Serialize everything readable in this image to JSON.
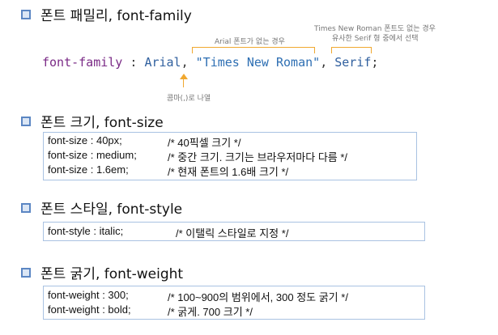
{
  "family": {
    "heading": "폰트 패밀리, font-family",
    "code": {
      "prop": "font-family",
      "colon": " : ",
      "v1": "Arial",
      "comma": ", ",
      "v2": "\"Times New Roman\"",
      "v3": "Serif",
      "semi": ";"
    },
    "note_arial": "Arial 폰트가 없는 경우",
    "note_times_1": "Times New Roman 폰트도 없는 경우",
    "note_times_2": "유사한 Serif 형 중에서 선택",
    "note_comma": "콤마(,)로 나열"
  },
  "size": {
    "heading": "폰트 크기, font-size",
    "rows": [
      {
        "code": "font-size : 40px;",
        "comment": "/* 40픽셀 크기 */"
      },
      {
        "code": "font-size : medium;",
        "comment": "/* 중간 크기. 크기는 브라우저마다 다름 */"
      },
      {
        "code": "font-size : 1.6em;",
        "comment": "/* 현재 폰트의 1.6배 크기 */"
      }
    ]
  },
  "style": {
    "heading": "폰트 스타일, font-style",
    "rows": [
      {
        "code": "font-style : italic;",
        "comment": "/* 이탤릭 스타일로 지정 */"
      }
    ]
  },
  "weight": {
    "heading": "폰트 굵기, font-weight",
    "rows": [
      {
        "code": "font-weight : 300;",
        "comment": "/* 100~900의 범위에서, 300 정도 굵기 */"
      },
      {
        "code": "font-weight : bold;",
        "comment": "/* 굵게. 700 크기 */"
      }
    ]
  },
  "colors": {
    "bullet": "#5b86c3",
    "bracket": "#f0a830",
    "prop": "#7a2a86",
    "value": "#2f5f9e",
    "box_border": "#a9c2e2"
  }
}
